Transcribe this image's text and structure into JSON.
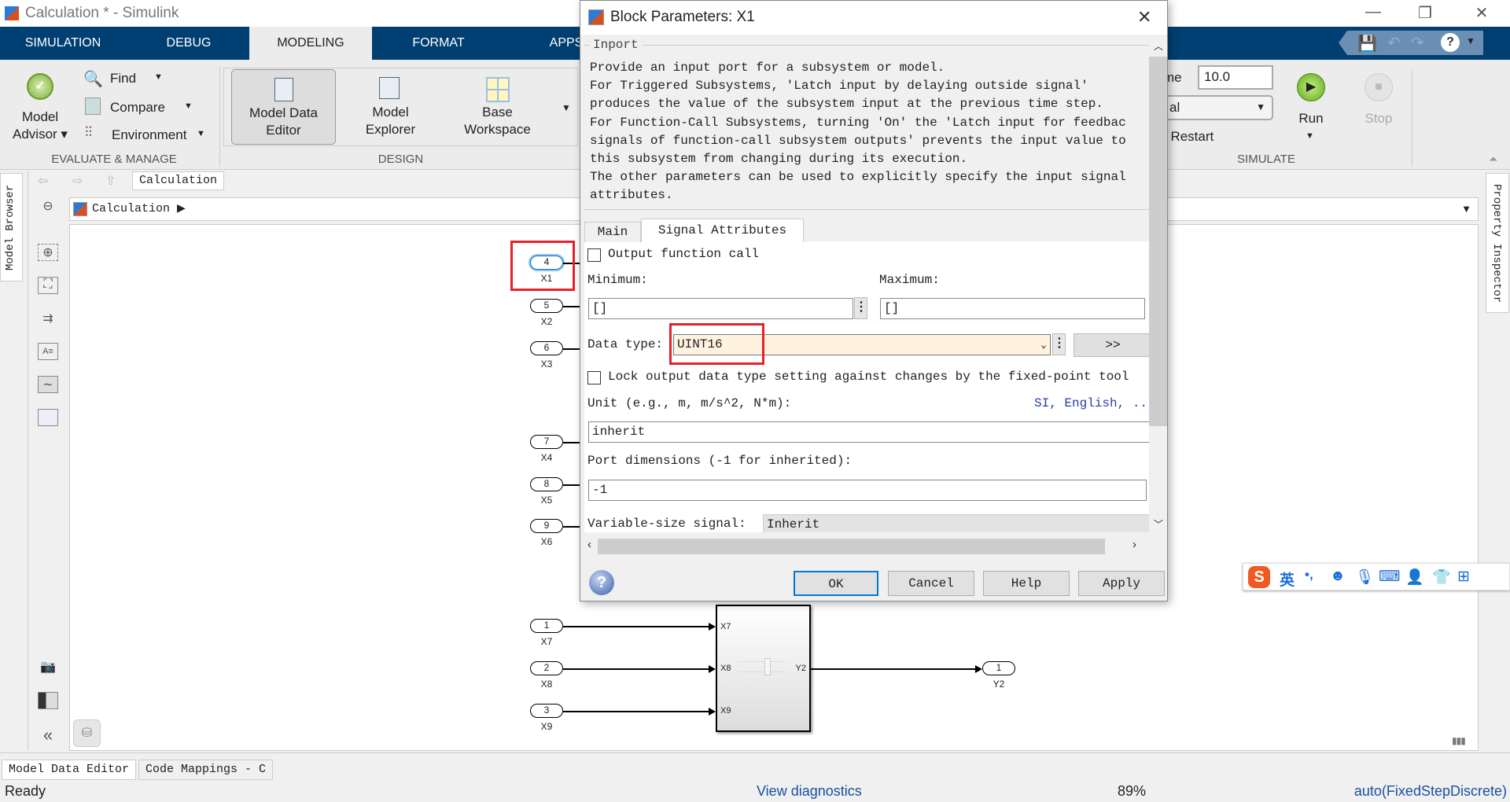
{
  "window": {
    "title": "Calculation * - Simulink",
    "minimize": "—",
    "maximize": "❐",
    "close": "✕"
  },
  "ribbon_tabs": [
    "SIMULATION",
    "DEBUG",
    "MODELING",
    "FORMAT",
    "APPS"
  ],
  "active_tab": "MODELING",
  "evaluate": {
    "model_advisor_1": "Model",
    "model_advisor_2": "Advisor ▾",
    "find": "Find",
    "compare": "Compare",
    "environment": "Environment",
    "label": "EVALUATE & MANAGE"
  },
  "design": {
    "model_data_editor_1": "Model Data",
    "model_data_editor_2": "Editor",
    "model_explorer_1": "Model",
    "model_explorer_2": "Explorer",
    "base_workspace_1": "Base",
    "base_workspace_2": "Workspace",
    "label": "DESIGN"
  },
  "simulate": {
    "stop_time_label": "me",
    "stop_time": "10.0",
    "mode": "al",
    "fast_restart": "t Restart",
    "run": "Run",
    "stop": "Stop",
    "label": "SIMULATE"
  },
  "explorer": {
    "tab": "Calculation",
    "address": "Calculation"
  },
  "side_tabs": {
    "model_browser": "Model Browser",
    "property_inspector": "Property Inspector"
  },
  "diagram": {
    "inports": [
      {
        "num": "4",
        "name": "X1"
      },
      {
        "num": "5",
        "name": "X2"
      },
      {
        "num": "6",
        "name": "X3"
      },
      {
        "num": "7",
        "name": "X4"
      },
      {
        "num": "8",
        "name": "X5"
      },
      {
        "num": "9",
        "name": "X6"
      },
      {
        "num": "1",
        "name": "X7"
      },
      {
        "num": "2",
        "name": "X8"
      },
      {
        "num": "3",
        "name": "X9"
      }
    ],
    "subsystem": {
      "inputs": [
        "X7",
        "X8",
        "X9"
      ],
      "output": "Y2"
    },
    "outport": {
      "num": "1",
      "name": "Y2"
    }
  },
  "dialog": {
    "title": "Block Parameters: X1",
    "group": "Inport",
    "description": [
      "Provide an input port for a subsystem or model.",
      "For Triggered Subsystems, 'Latch input by delaying outside signal'",
      "produces the value of the subsystem input at the previous time step.",
      "For Function-Call Subsystems, turning 'On' the 'Latch input for feedbac",
      "signals of function-call subsystem outputs' prevents the input value to",
      "this subsystem from changing during its execution.",
      "The other parameters can be used to explicitly specify the input signal",
      "attributes."
    ],
    "tabs": [
      "Main",
      "Signal Attributes"
    ],
    "output_function_call": "Output function call",
    "minimum_label": "Minimum:",
    "minimum": "[]",
    "maximum_label": "Maximum:",
    "maximum": "[]",
    "data_type_label": "Data type:",
    "data_type": "UINT16",
    "expand": ">>",
    "lock_label": "Lock output data type setting against changes by the fixed-point tool",
    "unit_label": "Unit (e.g., m, m/s^2, N*m):",
    "unit_link": "SI, English, ...",
    "unit": "inherit",
    "port_dims_label": "Port dimensions (-1 for inherited):",
    "port_dims": "-1",
    "var_size_label": "Variable-size signal:",
    "var_size": "Inherit",
    "buttons": {
      "ok": "OK",
      "cancel": "Cancel",
      "help": "Help",
      "apply": "Apply"
    }
  },
  "ime": {
    "lang": "英",
    "punct": "•,"
  },
  "bottom_tabs": [
    "Model Data Editor",
    "Code Mappings - C"
  ],
  "status": {
    "left": "Ready",
    "diagnostics": "View diagnostics",
    "zoom": "89%",
    "solver": "auto(FixedStepDiscrete)"
  }
}
